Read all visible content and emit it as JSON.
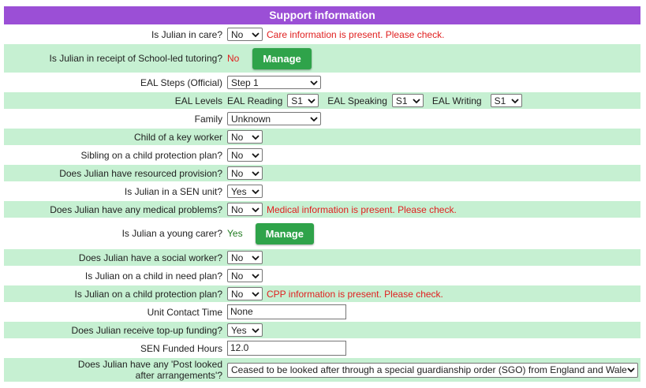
{
  "header": {
    "title": "Support information"
  },
  "rows": {
    "in_care": {
      "label": "Is Julian in care?",
      "value": "No",
      "warning": "Care information is present. Please check."
    },
    "tutoring": {
      "label": "Is Julian in receipt of School-led tutoring?",
      "value": "No",
      "button": "Manage"
    },
    "eal_steps": {
      "label": "EAL Steps (Official)",
      "value": "Step 1"
    },
    "eal_levels": {
      "label": "EAL Levels",
      "reading_label": "EAL Reading",
      "reading_value": "S1",
      "speaking_label": "EAL Speaking",
      "speaking_value": "S1",
      "writing_label": "EAL Writing",
      "writing_value": "S1"
    },
    "family": {
      "label": "Family",
      "value": "Unknown"
    },
    "key_worker": {
      "label": "Child of a key worker",
      "value": "No"
    },
    "sibling_cpp": {
      "label": "Sibling on a child protection plan?",
      "value": "No"
    },
    "resourced": {
      "label": "Does Julian have resourced provision?",
      "value": "No"
    },
    "sen_unit": {
      "label": "Is Julian in a SEN unit?",
      "value": "Yes"
    },
    "medical": {
      "label": "Does Julian have any medical problems?",
      "value": "No",
      "warning": "Medical information is present. Please check."
    },
    "young_carer": {
      "label": "Is Julian a young carer?",
      "value": "Yes",
      "button": "Manage"
    },
    "social_worker": {
      "label": "Does Julian have a social worker?",
      "value": "No"
    },
    "cin": {
      "label": "Is Julian on a child in need plan?",
      "value": "No"
    },
    "cpp": {
      "label": "Is Julian on a child protection plan?",
      "value": "No",
      "warning": "CPP information is present. Please check."
    },
    "unit_contact": {
      "label": "Unit Contact Time",
      "value": "None"
    },
    "topup": {
      "label": "Does Julian receive top-up funding?",
      "value": "Yes"
    },
    "sen_hours": {
      "label": "SEN Funded Hours",
      "value": "12.0"
    },
    "post_lac": {
      "label": "Does Julian have any 'Post looked after arrangements'?",
      "value": "Ceased to be looked after through a special guardianship order (SGO) from England and Wales"
    }
  },
  "colors": {
    "header": "#9b4fd6",
    "row_green": "#c6f0d2",
    "warning": "#e02020",
    "button": "#2fa34a"
  }
}
